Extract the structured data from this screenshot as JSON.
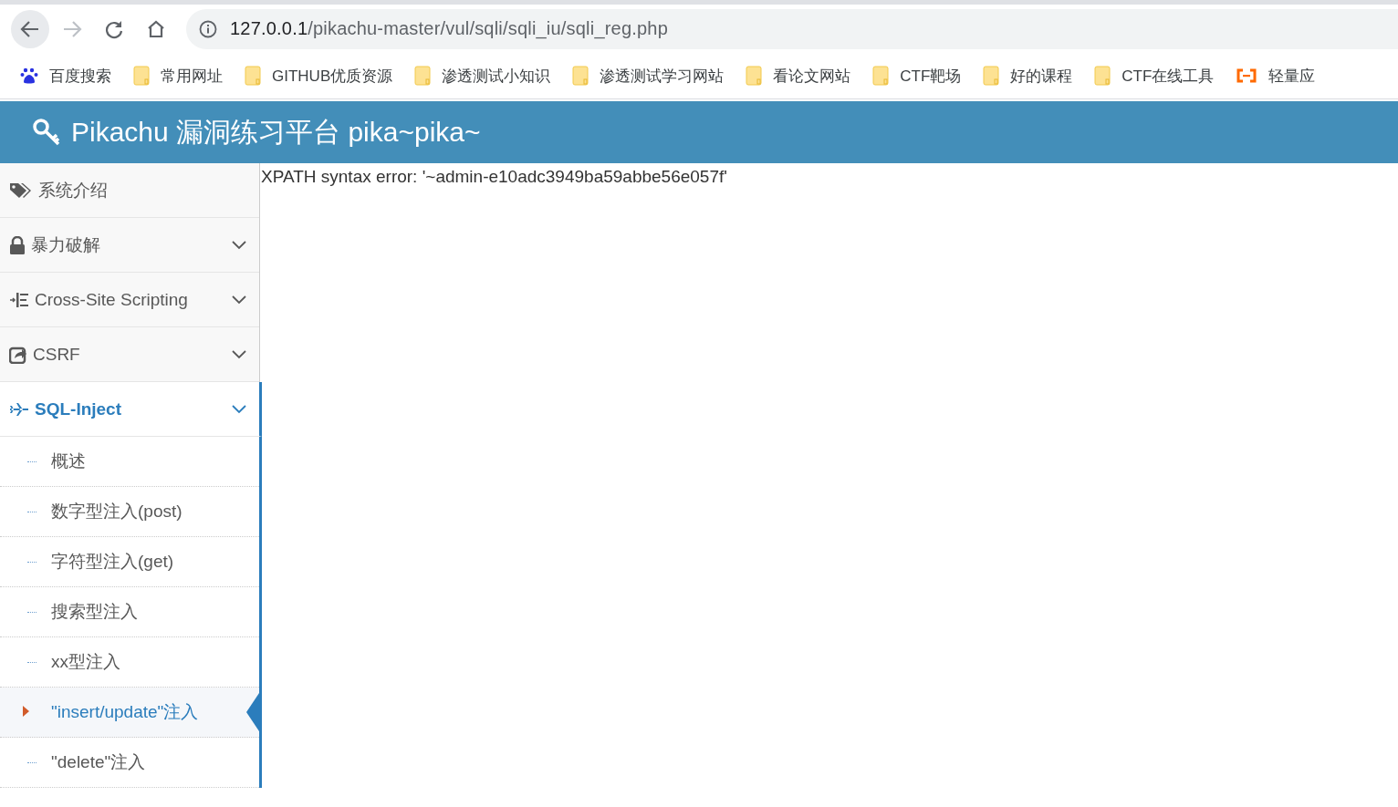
{
  "browser": {
    "url_host": "127.0.0.1",
    "url_path": "/pikachu-master/vul/sqli/sqli_iu/sqli_reg.php",
    "bookmarks": [
      {
        "label": "百度搜索",
        "kind": "paw"
      },
      {
        "label": "常用网址",
        "kind": "folder"
      },
      {
        "label": "GITHUB优质资源",
        "kind": "folder"
      },
      {
        "label": "渗透测试小知识",
        "kind": "folder"
      },
      {
        "label": "渗透测试学习网站",
        "kind": "folder"
      },
      {
        "label": "看论文网站",
        "kind": "folder"
      },
      {
        "label": "CTF靶场",
        "kind": "folder"
      },
      {
        "label": "好的课程",
        "kind": "folder"
      },
      {
        "label": "CTF在线工具",
        "kind": "folder"
      },
      {
        "label": "轻量应",
        "kind": "cloud"
      }
    ]
  },
  "header": {
    "title": "Pikachu 漏洞练习平台 pika~pika~"
  },
  "sidebar": {
    "items": [
      {
        "label": "系统介绍",
        "has_submenu": false,
        "expanded": false
      },
      {
        "label": "暴力破解",
        "has_submenu": true,
        "expanded": false
      },
      {
        "label": "Cross-Site Scripting",
        "has_submenu": true,
        "expanded": false
      },
      {
        "label": "CSRF",
        "has_submenu": true,
        "expanded": false
      },
      {
        "label": "SQL-Inject",
        "has_submenu": true,
        "expanded": true,
        "children": [
          {
            "label": "概述",
            "selected": false
          },
          {
            "label": "数字型注入(post)",
            "selected": false
          },
          {
            "label": "字符型注入(get)",
            "selected": false
          },
          {
            "label": "搜索型注入",
            "selected": false
          },
          {
            "label": "xx型注入",
            "selected": false
          },
          {
            "label": "\"insert/update\"注入",
            "selected": true
          },
          {
            "label": "\"delete\"注入",
            "selected": false
          }
        ]
      }
    ]
  },
  "content": {
    "message": "XPATH syntax error: '~admin-e10adc3949ba59abbe56e057f'"
  }
}
